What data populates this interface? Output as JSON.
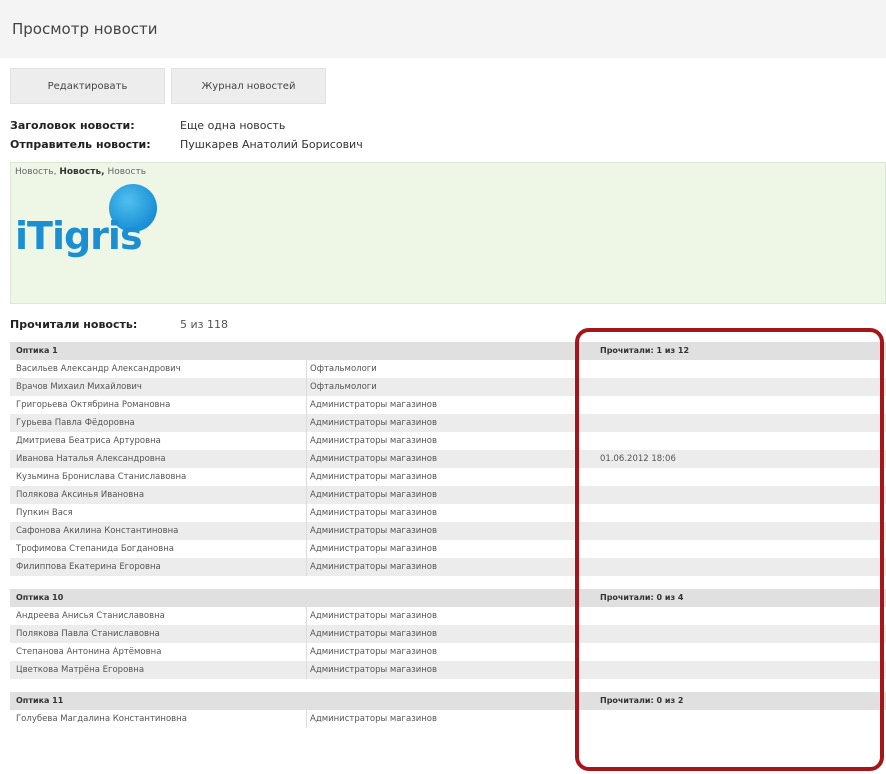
{
  "page": {
    "title": "Просмотр новости",
    "buttons": {
      "edit": "Редактировать",
      "journal": "Журнал новостей"
    }
  },
  "news": {
    "title_label": "Заголовок новости:",
    "title_value": "Еще одна новость",
    "sender_label": "Отправитель новости:",
    "sender_value": "Пушкарев Анатолий Борисович",
    "content": {
      "part1": "Новость,",
      "part2": "Новость,",
      "part3": "Новость"
    },
    "logo": {
      "text": "iTigris",
      "icon": "blue-ball-logo-icon",
      "color": "#1c8fd3"
    }
  },
  "read_stats": {
    "label": "Прочитали новость:",
    "value": "5 из 118"
  },
  "groups": [
    {
      "name": "Оптика 1",
      "count": "Прочитали: 1 из 12",
      "rows": [
        {
          "name": "Васильев Александр Александрович",
          "role": "Офтальмологи",
          "date": ""
        },
        {
          "name": "Врачов Михаил Михайлович",
          "role": "Офтальмологи",
          "date": ""
        },
        {
          "name": "Григорьева Октябрина Романовна",
          "role": "Администраторы магазинов",
          "date": ""
        },
        {
          "name": "Гурьева Павла Фёдоровна",
          "role": "Администраторы магазинов",
          "date": ""
        },
        {
          "name": "Дмитриева Беатриса Артуровна",
          "role": "Администраторы магазинов",
          "date": ""
        },
        {
          "name": "Иванова Наталья Александровна",
          "role": "Администраторы магазинов",
          "date": "01.06.2012 18:06"
        },
        {
          "name": "Кузьмина Бронислава Станиславовна",
          "role": "Администраторы магазинов",
          "date": ""
        },
        {
          "name": "Полякова Аксинья Ивановна",
          "role": "Администраторы магазинов",
          "date": ""
        },
        {
          "name": "Пупкин Вася",
          "role": "Администраторы магазинов",
          "date": ""
        },
        {
          "name": "Сафонова Акилина Константиновна",
          "role": "Администраторы магазинов",
          "date": ""
        },
        {
          "name": "Трофимова Степанида Богдановна",
          "role": "Администраторы магазинов",
          "date": ""
        },
        {
          "name": "Филиппова Екатерина Егоровна",
          "role": "Администраторы магазинов",
          "date": ""
        }
      ]
    },
    {
      "name": "Оптика 10",
      "count": "Прочитали: 0 из 4",
      "rows": [
        {
          "name": "Андреева Анисья Станиславовна",
          "role": "Администраторы магазинов",
          "date": ""
        },
        {
          "name": "Полякова Павла Станиславовна",
          "role": "Администраторы магазинов",
          "date": ""
        },
        {
          "name": "Степанова Антонина Артёмовна",
          "role": "Администраторы магазинов",
          "date": ""
        },
        {
          "name": "Цветкова Матрёна Егоровна",
          "role": "Администраторы магазинов",
          "date": ""
        }
      ]
    },
    {
      "name": "Оптика 11",
      "count": "Прочитали: 0 из 2",
      "rows": [
        {
          "name": "Голубева Магдалина Константиновна",
          "role": "Администраторы магазинов",
          "date": ""
        }
      ]
    }
  ],
  "highlight_color": "#a4161a"
}
